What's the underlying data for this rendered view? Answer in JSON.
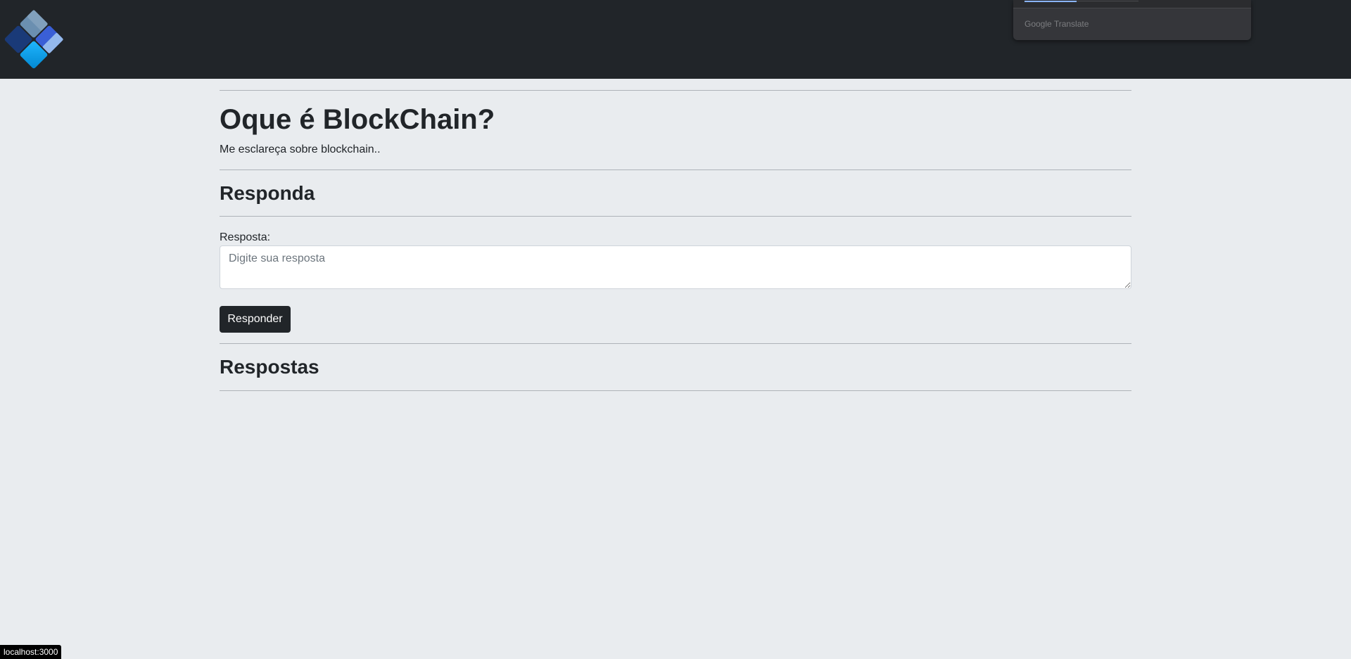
{
  "navbar": {
    "logo_icon": "blockchain-diamond-logo-icon"
  },
  "translate_popup": {
    "label": "Google Translate"
  },
  "question": {
    "title": "Oque é BlockChain?",
    "description": "Me esclareça sobre blockchain.."
  },
  "answer_form": {
    "heading": "Responda",
    "label": "Resposta:",
    "placeholder": "Digite sua resposta",
    "value": "",
    "submit_label": "Responder"
  },
  "answers": {
    "heading": "Respostas",
    "items": []
  },
  "status_bar": {
    "url": "localhost:3000"
  },
  "colors": {
    "navbar_bg": "#212529",
    "page_bg": "#e9ecef",
    "button_bg": "#212529",
    "logo_light_blue": "#03a9f4",
    "logo_dark_blue": "#1e3a8a"
  }
}
